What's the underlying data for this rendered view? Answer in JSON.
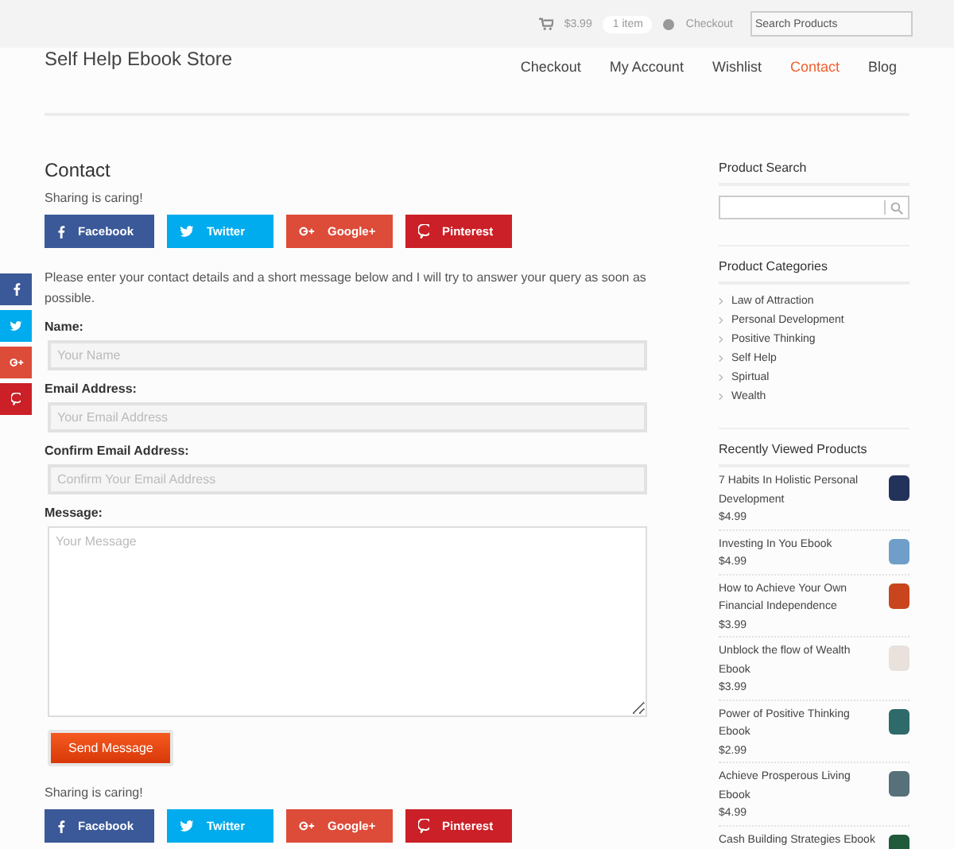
{
  "top_bar": {
    "cart_total": "$3.99",
    "cart_count": "1 item",
    "checkout": "Checkout",
    "search": {
      "placeholder": "Search Products"
    }
  },
  "site_title": "Self Help Ebook Store",
  "nav": [
    {
      "label": "Checkout",
      "selected": false
    },
    {
      "label": "My Account",
      "selected": false
    },
    {
      "label": "Wishlist",
      "selected": false
    },
    {
      "label": "Contact",
      "selected": true
    },
    {
      "label": "Blog",
      "selected": false
    }
  ],
  "page_title": "Contact",
  "share_top": {
    "caption": "Sharing is caring!",
    "buttons": [
      {
        "kind": "facebook",
        "label": "Facebook"
      },
      {
        "kind": "twitter",
        "label": "Twitter"
      },
      {
        "kind": "google",
        "label": "Google+"
      },
      {
        "kind": "pinterest",
        "label": "Pinterest"
      }
    ]
  },
  "floating_share": [
    {
      "kind": "facebook"
    },
    {
      "kind": "twitter"
    },
    {
      "kind": "google"
    },
    {
      "kind": "pinterest"
    }
  ],
  "intro": "Please enter your contact details and a short message below and I will try to answer your query as soon as possible.",
  "fields": [
    {
      "label": "Name:",
      "placeholder": "Your Name",
      "kind": "text"
    },
    {
      "label": "Email Address:",
      "placeholder": "Your Email Address",
      "kind": "text"
    },
    {
      "label": "Confirm Email Address:",
      "placeholder": "Confirm Your Email Address",
      "kind": "text"
    },
    {
      "label": "Message:",
      "placeholder": "Your Message",
      "kind": "textarea"
    }
  ],
  "submit": "Send Message",
  "share_bottom": {
    "caption": "Sharing is caring!",
    "buttons": [
      {
        "kind": "facebook",
        "label": "Facebook"
      },
      {
        "kind": "twitter",
        "label": "Twitter"
      },
      {
        "kind": "google",
        "label": "Google+"
      },
      {
        "kind": "pinterest",
        "label": "Pinterest"
      }
    ]
  },
  "sidebar": {
    "search_title": "Product Search",
    "categories_title": "Product Categories",
    "categories": [
      "Law of Attraction",
      "Personal Development",
      "Positive Thinking",
      "Self Help",
      "Spirtual",
      "Wealth"
    ],
    "recent_title": "Recently Viewed Products",
    "recent": [
      {
        "name": "7 Habits In Holistic Personal Development",
        "price": "$4.99"
      },
      {
        "name": "Investing In You Ebook",
        "price": "$4.99"
      },
      {
        "name": "How to Achieve Your Own Financial Independence",
        "price": "$3.99"
      },
      {
        "name": "Unblock the flow of Wealth Ebook",
        "price": "$3.99"
      },
      {
        "name": "Power of Positive Thinking Ebook",
        "price": "$2.99"
      },
      {
        "name": "Achieve Prosperous Living Ebook",
        "price": "$4.99"
      },
      {
        "name": "Cash Building Strategies Ebook"
      }
    ]
  }
}
